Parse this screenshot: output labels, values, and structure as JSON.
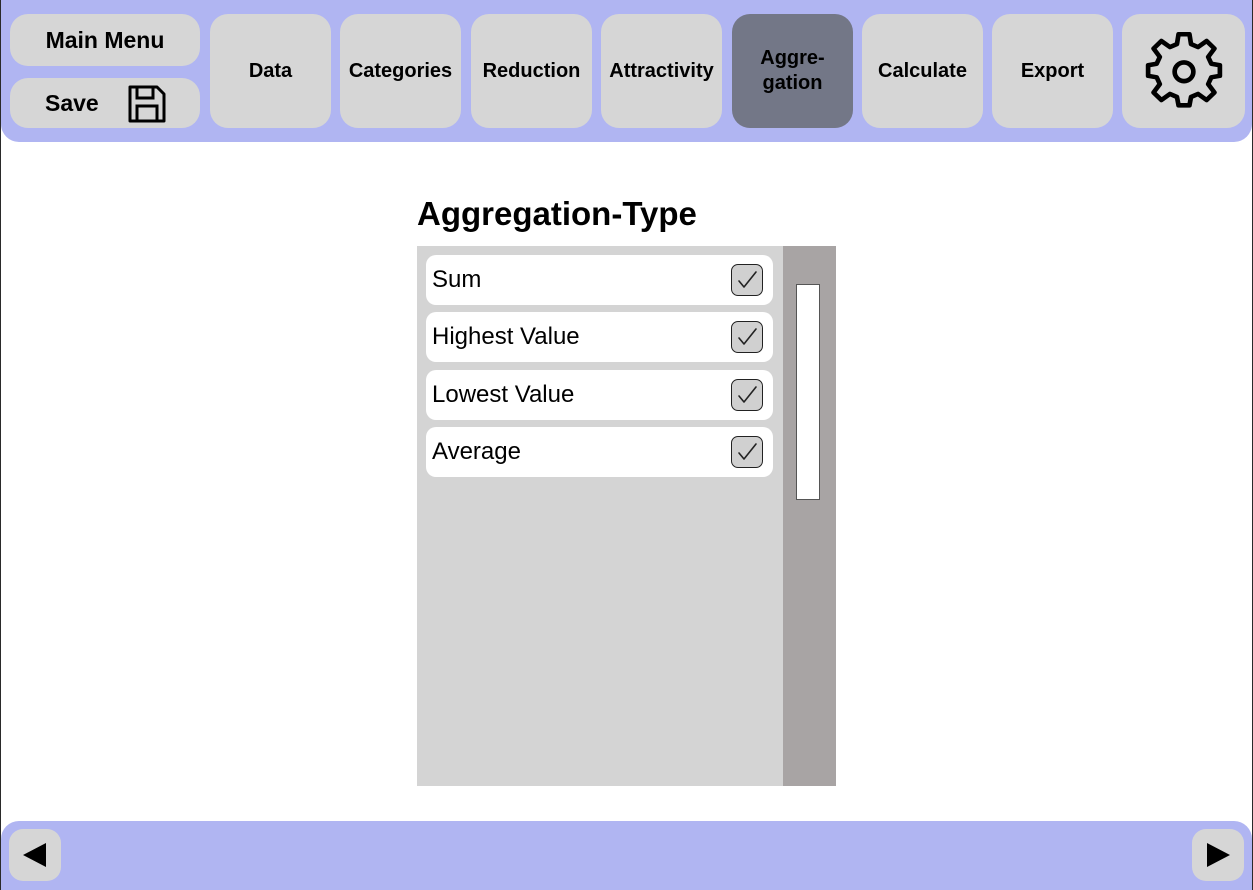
{
  "header": {
    "main_menu_label": "Main Menu",
    "save_label": "Save",
    "save_icon": "floppy-disk-icon",
    "settings_icon": "gear-icon",
    "tabs": [
      {
        "label": "Data",
        "active": false
      },
      {
        "label": "Categories",
        "active": false
      },
      {
        "label": "Reduction",
        "active": false
      },
      {
        "label": "Attractivity",
        "active": false
      },
      {
        "label": "Aggre-\ngation",
        "active": true
      },
      {
        "label": "Calculate",
        "active": false
      },
      {
        "label": "Export",
        "active": false
      }
    ]
  },
  "main": {
    "title": "Aggregation-Type",
    "items": [
      {
        "label": "Sum",
        "checked": true
      },
      {
        "label": "Highest Value",
        "checked": true
      },
      {
        "label": "Lowest Value",
        "checked": true
      },
      {
        "label": "Average",
        "checked": true
      }
    ]
  },
  "footer": {
    "prev_icon": "left-arrow-icon",
    "next_icon": "right-arrow-icon"
  },
  "colors": {
    "bar_background": "#b0b5f2",
    "button_background": "#d6d6d6",
    "active_tab": "#737787",
    "list_background": "#d4d4d4",
    "scrollbar_track": "#a8a4a4"
  }
}
